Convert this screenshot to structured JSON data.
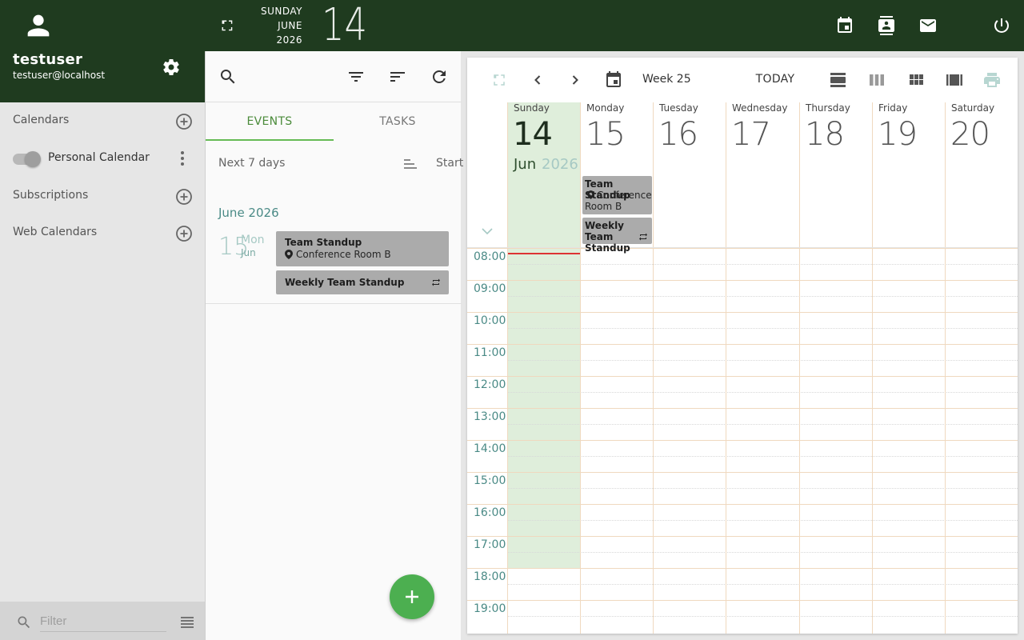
{
  "user": {
    "name": "testuser",
    "email": "testuser@localhost"
  },
  "topbar": {
    "weekday": "SUNDAY",
    "month": "JUNE",
    "year": "2026",
    "day": "14"
  },
  "sidebar": {
    "calendars_label": "Calendars",
    "personal_calendar": "Personal Calendar",
    "subscriptions_label": "Subscriptions",
    "web_calendars_label": "Web Calendars",
    "filter_placeholder": "Filter"
  },
  "list": {
    "tabs": [
      "EVENTS",
      "TASKS"
    ],
    "range": "Next 7 days",
    "sort": "Start",
    "month_heading": "June 2026",
    "group": {
      "day": "15",
      "weekday": "Mon",
      "month": "Jun"
    },
    "events": [
      {
        "title": "Team Standup",
        "location": "Conference Room B",
        "recurring": false
      },
      {
        "title": "Weekly Team Standup",
        "recurring": true
      }
    ]
  },
  "calendar": {
    "week_label": "Week 25",
    "today_label": "TODAY",
    "days": [
      {
        "name": "Sunday",
        "num": "14"
      },
      {
        "name": "Monday",
        "num": "15"
      },
      {
        "name": "Tuesday",
        "num": "16"
      },
      {
        "name": "Wednesday",
        "num": "17"
      },
      {
        "name": "Thursday",
        "num": "18"
      },
      {
        "name": "Friday",
        "num": "19"
      },
      {
        "name": "Saturday",
        "num": "20"
      }
    ],
    "today_month": "Jun",
    "today_year": "2026",
    "hours": [
      "08:00",
      "09:00",
      "10:00",
      "11:00",
      "12:00",
      "13:00",
      "14:00",
      "15:00",
      "16:00",
      "17:00",
      "18:00",
      "19:00"
    ],
    "events": [
      {
        "title": "Team Standup",
        "location": "Conference Room B"
      },
      {
        "title": "Weekly Team Standup",
        "recurring": true
      }
    ]
  },
  "colors": {
    "header": "#1f3b1f",
    "accent": "#4caf50",
    "today_bg": "#dfeedb",
    "event_bg": "#ababab",
    "now_line": "#dd3333"
  },
  "icons": [
    "person-icon",
    "gear-icon",
    "fullscreen-icon",
    "calendar-icon",
    "contacts-icon",
    "mail-icon",
    "power-icon",
    "add-circle-icon",
    "more-vert-icon",
    "search-icon",
    "filter-icon",
    "sort-icon",
    "refresh-icon",
    "chevron-left-icon",
    "chevron-right-icon",
    "chevron-down-icon",
    "view-day-icon",
    "view-week-icon",
    "view-month-icon",
    "view-module-icon",
    "print-icon",
    "location-pin-icon",
    "repeat-icon",
    "plus-icon",
    "list-icon"
  ]
}
